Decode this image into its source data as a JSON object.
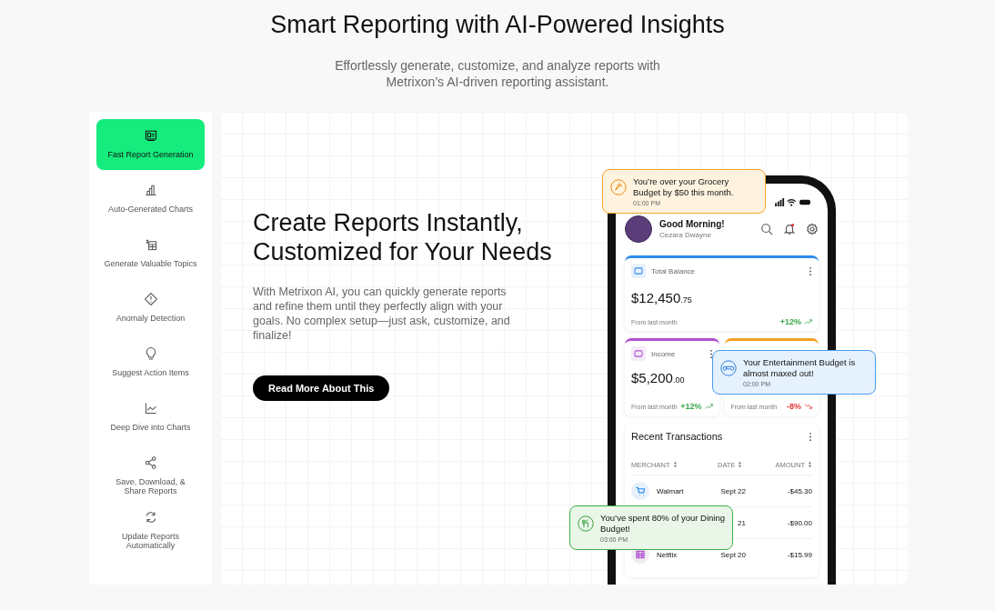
{
  "header": {
    "title": "Smart Reporting with AI-Powered Insights",
    "subtitle": "Effortlessly generate, customize, and analyze reports with Metrixon’s AI-driven reporting assistant."
  },
  "sidebar": {
    "items": [
      {
        "label": "Fast Report Generation",
        "selected": true
      },
      {
        "label": "Auto-Generated Charts",
        "selected": false
      },
      {
        "label": "Generate Valuable Topics",
        "selected": false
      },
      {
        "label": "Anomaly Detection",
        "selected": false
      },
      {
        "label": "Suggest Action Items",
        "selected": false
      },
      {
        "label": "Deep Dive into Charts",
        "selected": false
      },
      {
        "label": "Save, Download, & Share Reports",
        "selected": false
      },
      {
        "label": "Update Reports Automatically",
        "selected": false
      }
    ]
  },
  "feature": {
    "heading": "Create Reports Instantly, Customized for Your Needs",
    "body": "With Metrixon AI, you can quickly generate reports and refine them until they perfectly align with your goals. No complex setup—just ask, customize, and finalize!",
    "button": "Read More About This"
  },
  "phone": {
    "greeting": "Good Morning!",
    "user_name": "Cezara Dwayne",
    "cards": [
      {
        "kind": "wide",
        "color": "#2f8cf0",
        "label": "Total Balance",
        "amount": "$12,450",
        "cents": ".75",
        "note": "From last month",
        "change": {
          "text": "+12%",
          "color": "#3aa84a"
        }
      },
      {
        "kind": "half",
        "color": "#b04fd0",
        "label": "Income",
        "amount": "$5,200",
        "cents": ".00",
        "note": "From last month",
        "change": {
          "text": "+12%",
          "color": "#3aa84a"
        }
      },
      {
        "kind": "half",
        "color": "#f5a020",
        "note": "From last month",
        "change": {
          "text": "-8%",
          "color": "#e53935"
        }
      }
    ],
    "transactions": {
      "title": "Recent Transactions",
      "columns": [
        "MERCHANT",
        "DATE",
        "AMOUNT"
      ],
      "rows": [
        {
          "merchant": "Walmart",
          "date": "Sept 22",
          "amount": "-$45.30"
        },
        {
          "date": "21",
          "amount": "-$90.00"
        },
        {
          "merchant": "Netflix",
          "date": "Sept 20",
          "amount": "-$15.99"
        }
      ]
    },
    "notifications": [
      {
        "kind": "warning",
        "text": "You’re over your Grocery Budget by $50 this month.",
        "time": "01:00 PM"
      },
      {
        "kind": "info",
        "text": "Your Entertainment Budget is almost maxed out!",
        "time": "02:00 PM"
      },
      {
        "kind": "success",
        "text": "You’ve spent 80% of your Dining Budget!",
        "time": "03:00 PM"
      }
    ]
  }
}
